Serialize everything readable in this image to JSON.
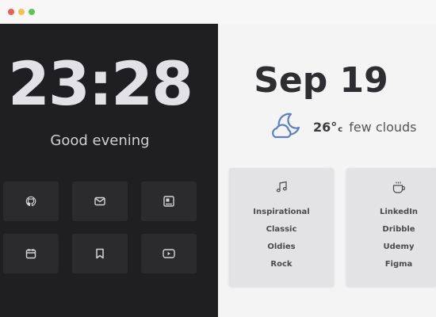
{
  "clock": {
    "time": "23:28",
    "greeting": "Good evening"
  },
  "shortcuts": [
    {
      "icon": "github-icon"
    },
    {
      "icon": "mail-icon"
    },
    {
      "icon": "image-icon"
    },
    {
      "icon": "calendar-icon"
    },
    {
      "icon": "bookmark-icon"
    },
    {
      "icon": "youtube-icon"
    }
  ],
  "date": "Sep 19",
  "weather": {
    "icon": "moon-cloud-icon",
    "temp": "26°",
    "unit": "c",
    "condition": "few clouds"
  },
  "cards": [
    {
      "icon": "music-note-icon",
      "items": [
        "Inspirational",
        "Classic",
        "Oldies",
        "Rock"
      ]
    },
    {
      "icon": "coffee-cup-icon",
      "items": [
        "LinkedIn",
        "Dribble",
        "Udemy",
        "Figma"
      ]
    }
  ],
  "colors": {
    "left_bg": "#1f1f21",
    "right_bg": "#f4f4f5",
    "accent_icon": "#5d7fc4"
  }
}
